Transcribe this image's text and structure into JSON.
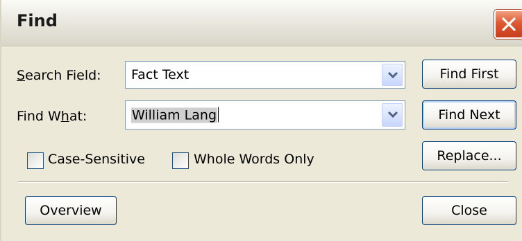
{
  "window": {
    "title": "Find",
    "close_icon": "close-icon"
  },
  "search_field": {
    "label_pre": "",
    "label_accel": "S",
    "label_post": "earch Field:",
    "value": "Fact Text"
  },
  "find_what": {
    "label_pre": "Find W",
    "label_accel": "h",
    "label_post": "at:",
    "value": "William Lang"
  },
  "options": {
    "case_sensitive": {
      "label": "Case-Sensitive",
      "checked": false
    },
    "whole_words": {
      "label": "Whole Words Only",
      "checked": false
    }
  },
  "buttons": {
    "find_first": "Find First",
    "find_next": "Find Next",
    "replace": "Replace...",
    "overview": "Overview",
    "close": "Close"
  }
}
